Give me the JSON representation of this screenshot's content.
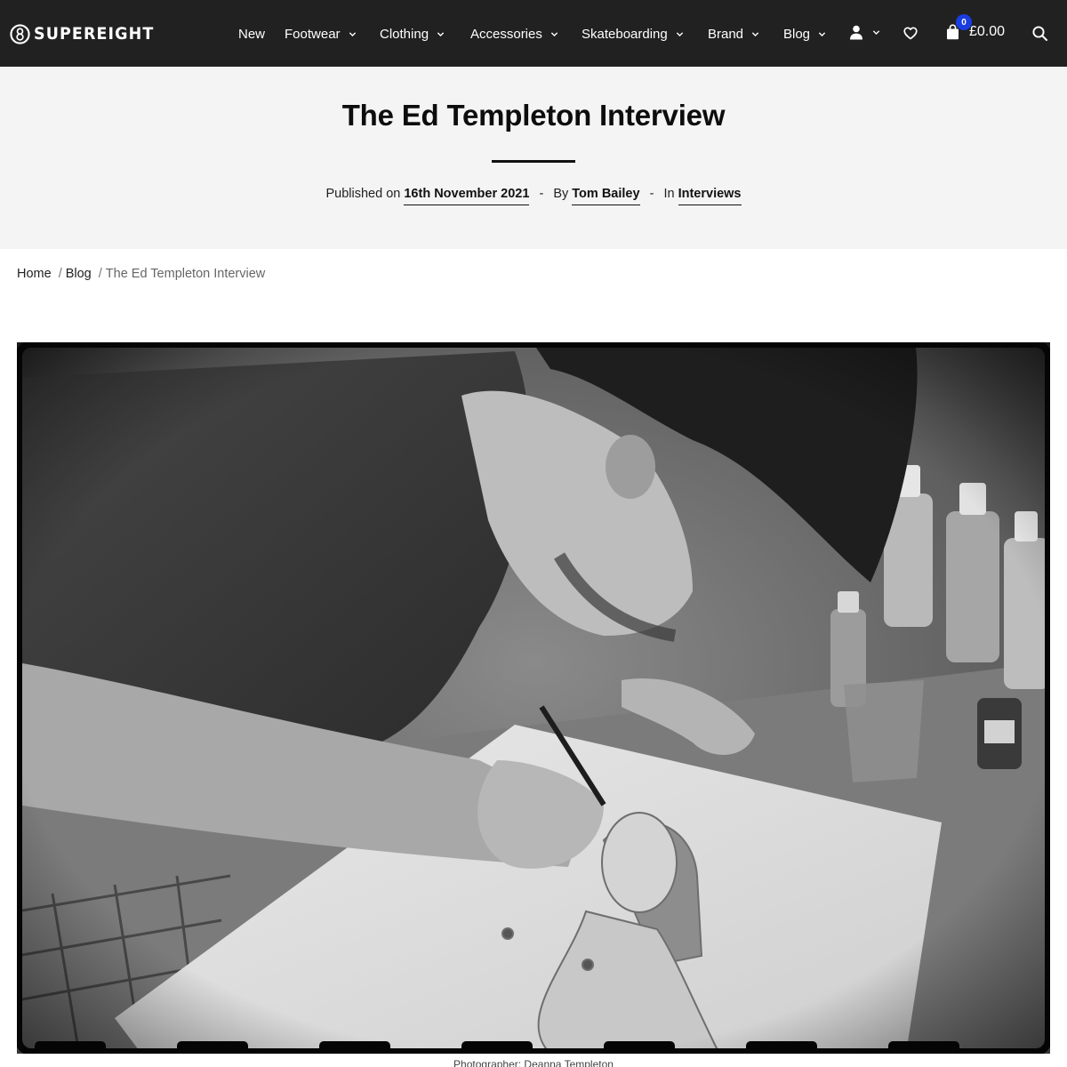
{
  "brand": {
    "name": "SUPEREIGHT"
  },
  "nav": {
    "items": [
      {
        "label": "New",
        "has_dropdown": false
      },
      {
        "label": "Footwear",
        "has_dropdown": true
      },
      {
        "label": "Clothing",
        "has_dropdown": true
      },
      {
        "label": "Accessories",
        "has_dropdown": true
      },
      {
        "label": "Skateboarding",
        "has_dropdown": true
      },
      {
        "label": "Brand",
        "has_dropdown": true
      },
      {
        "label": "Blog",
        "has_dropdown": true
      }
    ],
    "icons": [
      "user-icon",
      "chevron-down-icon",
      "heart-icon",
      "shopping-bag-icon",
      "search-icon"
    ],
    "cart": {
      "count": "0",
      "total": "£0.00"
    }
  },
  "article": {
    "title": "The Ed Templeton Interview",
    "published_prefix": "Published on",
    "date": "16th November 2021",
    "by_prefix": "By",
    "author": "Tom Bailey",
    "in_prefix": "In",
    "category": "Interviews",
    "separator": "-"
  },
  "breadcrumb": {
    "home": "Home",
    "blog": "Blog",
    "current": "The Ed Templeton Interview",
    "separator": "/"
  },
  "photo": {
    "alt": "Black and white photo of a man drawing a figure at a table of paint bottles",
    "caption": "Photographer: Deanna Templeton"
  },
  "colors": {
    "header_bg": "#212121",
    "hero_bg": "#f4f4f4",
    "badge": "#1a3ce0"
  }
}
